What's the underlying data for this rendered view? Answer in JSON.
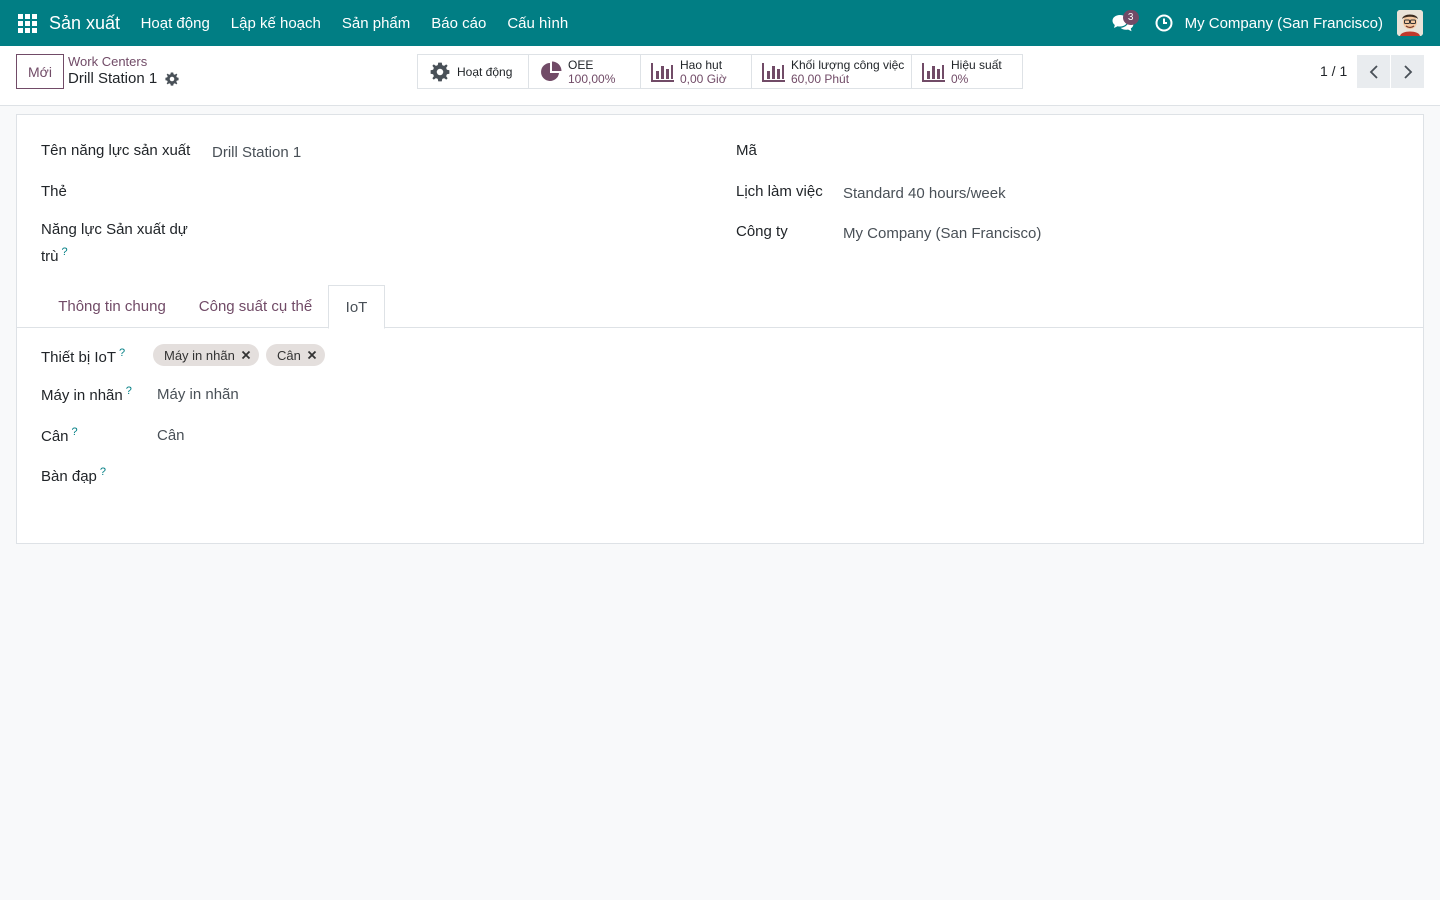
{
  "navbar": {
    "app_name": "Sản xuất",
    "menu": [
      "Hoạt động",
      "Lập kế hoạch",
      "Sản phẩm",
      "Báo cáo",
      "Cấu hình"
    ],
    "chat_count": "3",
    "company": "My Company (San Francisco)"
  },
  "control_panel": {
    "new_label": "Mới",
    "breadcrumb": "Work Centers",
    "record_name": "Drill Station 1",
    "stats": [
      {
        "label": "Hoạt động",
        "value": "",
        "icon": "gear-icon"
      },
      {
        "label": "OEE",
        "value": "100,00%",
        "icon": "pie-chart-icon"
      },
      {
        "label": "Hao hụt",
        "value": "0,00 Giờ",
        "icon": "bar-chart-icon"
      },
      {
        "label": "Khối lượng công việc",
        "value": "60,00 Phút",
        "icon": "bar-chart-icon"
      },
      {
        "label": "Hiệu suất",
        "value": "0%",
        "icon": "bar-chart-icon"
      }
    ],
    "pager": "1 / 1"
  },
  "form": {
    "name_label": "Tên năng lực sản xuất",
    "name_value": "Drill Station 1",
    "tag_label": "Thẻ",
    "alt_label_line1": "Năng lực Sản xuất dự",
    "alt_label_line2": "trù",
    "code_label": "Mã",
    "schedule_label": "Lịch làm việc",
    "schedule_value": "Standard 40 hours/week",
    "company_label": "Công ty",
    "company_value": "My Company (San Francisco)",
    "help_mark": "?"
  },
  "tabs": [
    "Thông tin chung",
    "Công suất cụ thể",
    "IoT"
  ],
  "iot": {
    "devices_label": "Thiết bị IoT",
    "devices": [
      "Máy in nhãn",
      "Cân"
    ],
    "printer_label": "Máy in nhãn",
    "printer_value": "Máy in nhãn",
    "scale_label": "Cân",
    "scale_value": "Cân",
    "pedal_label": "Bàn đạp"
  },
  "colors": {
    "navbar": "#017e84",
    "primary": "#714b67",
    "help": "#017e84"
  }
}
